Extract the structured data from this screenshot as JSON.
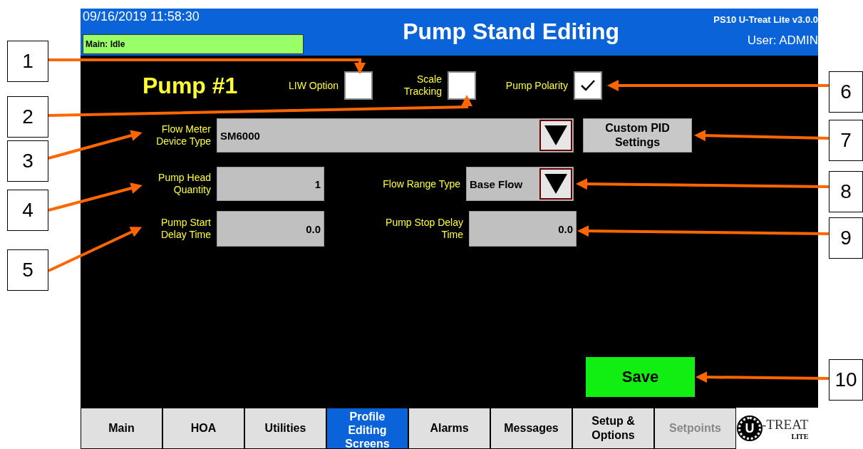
{
  "header": {
    "datetime": "09/16/2019 11:58:30",
    "status": "Main: Idle",
    "title": "Pump Stand Editing",
    "version": "PS10 U-Treat Lite v3.0.0",
    "user": "User: ADMIN"
  },
  "pump_title": "Pump #1",
  "options": [
    {
      "label": "LIW Option",
      "checked": false
    },
    {
      "label": "Scale Tracking",
      "checked": false
    },
    {
      "label": "Pump Polarity",
      "checked": true
    }
  ],
  "flow_meter": {
    "label": "Flow Meter Device Type",
    "value": "SM6000"
  },
  "custom_pid_button": "Custom PID Settings",
  "pump_head": {
    "label": "Pump Head Quantity",
    "value": "1"
  },
  "flow_range": {
    "label": "Flow Range Type",
    "value": "Base Flow"
  },
  "start_delay": {
    "label": "Pump Start Delay Time",
    "value": "0.0"
  },
  "stop_delay": {
    "label": "Pump Stop Delay Time",
    "value": "0.0"
  },
  "save_button": "Save",
  "tabs": [
    {
      "label": "Main",
      "selected": false,
      "disabled": false
    },
    {
      "label": "HOA",
      "selected": false,
      "disabled": false
    },
    {
      "label": "Utilities",
      "selected": false,
      "disabled": false
    },
    {
      "label": "Profile Editing Screens",
      "selected": true,
      "disabled": false
    },
    {
      "label": "Alarms",
      "selected": false,
      "disabled": false
    },
    {
      "label": "Messages",
      "selected": false,
      "disabled": false
    },
    {
      "label": "Setup & Options",
      "selected": false,
      "disabled": false
    },
    {
      "label": "Setpoints",
      "selected": false,
      "disabled": true
    }
  ],
  "logo": {
    "letter": "U",
    "text": "-TREAT",
    "subtext": "LITE"
  },
  "callouts": [
    "1",
    "2",
    "3",
    "4",
    "5",
    "6",
    "7",
    "8",
    "9",
    "10"
  ]
}
